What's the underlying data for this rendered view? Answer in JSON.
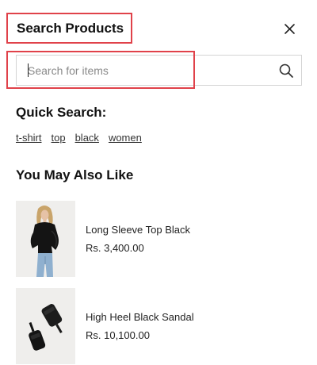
{
  "header": {
    "title": "Search Products",
    "close_icon": "close-icon"
  },
  "search": {
    "placeholder": "Search for items",
    "value": "",
    "icon": "search-icon"
  },
  "quick_search": {
    "title": "Quick Search:",
    "links": [
      "t-shirt",
      "top",
      "black",
      "women"
    ]
  },
  "recommendations": {
    "title": "You May Also Like",
    "products": [
      {
        "name": "Long Sleeve Top Black",
        "price": "Rs. 3,400.00"
      },
      {
        "name": "High Heel Black Sandal",
        "price": "Rs. 10,100.00"
      }
    ]
  },
  "colors": {
    "highlight": "#e0424a",
    "text": "#1a1a1a",
    "border": "#d4d4d4"
  }
}
